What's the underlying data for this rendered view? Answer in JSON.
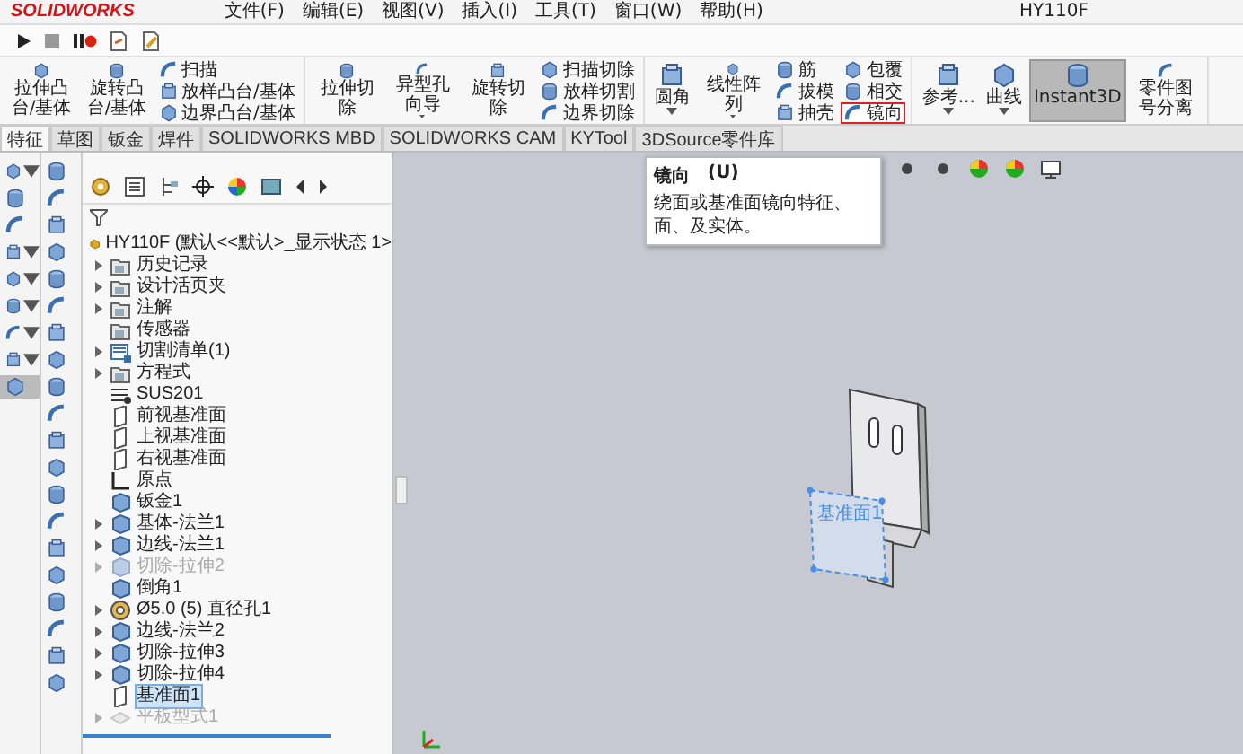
{
  "title_bar": {
    "logo": "SOLIDWORKS",
    "menus": [
      "文件(F)",
      "编辑(E)",
      "视图(V)",
      "插入(I)",
      "工具(T)",
      "窗口(W)",
      "帮助(H)"
    ],
    "document": "HY110F"
  },
  "command_manager": {
    "groups": [
      {
        "columns": [
          {
            "kind": "large",
            "label": "拉伸凸台/基体",
            "dropdown": false,
            "on": false
          },
          {
            "kind": "large",
            "label": "旋转凸台/基体",
            "dropdown": false,
            "on": false
          },
          {
            "kind": "stack",
            "items": [
              {
                "label": "扫描",
                "highlighted": false
              },
              {
                "label": "放样凸台/基体",
                "highlighted": false
              },
              {
                "label": "边界凸台/基体",
                "highlighted": false
              }
            ]
          }
        ]
      },
      {
        "columns": [
          {
            "kind": "large",
            "label": "拉伸切除",
            "dropdown": false,
            "on": false
          },
          {
            "kind": "large",
            "label": "异型孔向导",
            "dropdown": true,
            "on": false
          },
          {
            "kind": "large",
            "label": "旋转切除",
            "dropdown": false,
            "on": false
          },
          {
            "kind": "stack",
            "items": [
              {
                "label": "扫描切除",
                "highlighted": false
              },
              {
                "label": "放样切割",
                "highlighted": false
              },
              {
                "label": "边界切除",
                "highlighted": false
              }
            ]
          }
        ]
      },
      {
        "columns": [
          {
            "kind": "large",
            "label": "圆角",
            "dropdown": true,
            "on": false
          },
          {
            "kind": "large",
            "label": "线性阵列",
            "dropdown": true,
            "on": false
          },
          {
            "kind": "stack",
            "items": [
              {
                "label": "筋",
                "highlighted": false
              },
              {
                "label": "拔模",
                "highlighted": false
              },
              {
                "label": "抽壳",
                "highlighted": false
              }
            ]
          },
          {
            "kind": "stack",
            "items": [
              {
                "label": "包覆",
                "highlighted": false
              },
              {
                "label": "相交",
                "highlighted": false
              },
              {
                "label": "镜向",
                "highlighted": true
              }
            ]
          }
        ]
      },
      {
        "columns": [
          {
            "kind": "large",
            "label": "参考...",
            "dropdown": true,
            "on": false
          },
          {
            "kind": "large",
            "label": "曲线",
            "dropdown": true,
            "on": false
          },
          {
            "kind": "large",
            "label": "Instant3D",
            "dropdown": false,
            "on": true
          },
          {
            "kind": "large",
            "label": "零件图号分离",
            "dropdown": false,
            "on": false
          }
        ]
      }
    ]
  },
  "tabs": [
    {
      "label": "特征",
      "selected": true
    },
    {
      "label": "草图",
      "selected": false
    },
    {
      "label": "钣金",
      "selected": false
    },
    {
      "label": "焊件",
      "selected": false
    },
    {
      "label": "SOLIDWORKS MBD",
      "selected": false
    },
    {
      "label": "SOLIDWORKS CAM",
      "selected": false
    },
    {
      "label": "KYTool",
      "selected": false
    },
    {
      "label": "3DSource零件库",
      "selected": false
    }
  ],
  "tooltip": {
    "title": "镜向",
    "shortcut": "(U)",
    "description": "绕面或基准面镜向特征、面、及实体。"
  },
  "feature_tree": {
    "root": "HY110F (默认<<默认>_显示状态 1>",
    "items": [
      {
        "label": "历史记录",
        "kind": "folder",
        "expandable": true,
        "disabled": false,
        "selected": false
      },
      {
        "label": "设计活页夹",
        "kind": "folder",
        "expandable": true,
        "disabled": false,
        "selected": false
      },
      {
        "label": "注解",
        "kind": "folder",
        "expandable": true,
        "disabled": false,
        "selected": false
      },
      {
        "label": "传感器",
        "kind": "folder",
        "expandable": false,
        "disabled": false,
        "selected": false
      },
      {
        "label": "切割清单(1)",
        "kind": "list",
        "expandable": true,
        "disabled": false,
        "selected": false
      },
      {
        "label": "方程式",
        "kind": "folder",
        "expandable": true,
        "disabled": false,
        "selected": false
      },
      {
        "label": "SUS201",
        "kind": "material",
        "expandable": false,
        "disabled": false,
        "selected": false
      },
      {
        "label": "前视基准面",
        "kind": "plane",
        "expandable": false,
        "disabled": false,
        "selected": false
      },
      {
        "label": "上视基准面",
        "kind": "plane",
        "expandable": false,
        "disabled": false,
        "selected": false
      },
      {
        "label": "右视基准面",
        "kind": "plane",
        "expandable": false,
        "disabled": false,
        "selected": false
      },
      {
        "label": "原点",
        "kind": "origin",
        "expandable": false,
        "disabled": false,
        "selected": false
      },
      {
        "label": "钣金1",
        "kind": "feature",
        "expandable": false,
        "disabled": false,
        "selected": false
      },
      {
        "label": "基体-法兰1",
        "kind": "feature",
        "expandable": true,
        "disabled": false,
        "selected": false
      },
      {
        "label": "边线-法兰1",
        "kind": "feature",
        "expandable": true,
        "disabled": false,
        "selected": false
      },
      {
        "label": "切除-拉伸2",
        "kind": "feature",
        "expandable": true,
        "disabled": true,
        "selected": false
      },
      {
        "label": "倒角1",
        "kind": "feature",
        "expandable": false,
        "disabled": false,
        "selected": false
      },
      {
        "label": "Ø5.0 (5) 直径孔1",
        "kind": "hole",
        "expandable": true,
        "disabled": false,
        "selected": false
      },
      {
        "label": "边线-法兰2",
        "kind": "feature",
        "expandable": true,
        "disabled": false,
        "selected": false
      },
      {
        "label": "切除-拉伸3",
        "kind": "feature",
        "expandable": true,
        "disabled": false,
        "selected": false
      },
      {
        "label": "切除-拉伸4",
        "kind": "feature",
        "expandable": true,
        "disabled": false,
        "selected": false
      },
      {
        "label": "基准面1",
        "kind": "plane",
        "expandable": false,
        "disabled": false,
        "selected": true
      },
      {
        "label": "平板型式1",
        "kind": "flat",
        "expandable": true,
        "disabled": true,
        "selected": false
      }
    ]
  },
  "viewport": {
    "plane_label": "基准面1"
  }
}
